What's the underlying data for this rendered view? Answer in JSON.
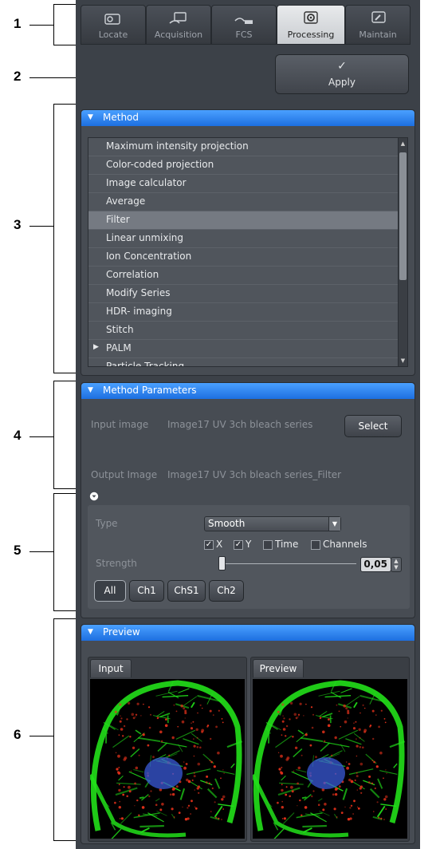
{
  "annotations": [
    "1",
    "2",
    "3",
    "4",
    "5",
    "6"
  ],
  "tabs": [
    {
      "label": "Locate",
      "icon": "locate-icon"
    },
    {
      "label": "Acquisition",
      "icon": "acquisition-icon"
    },
    {
      "label": "FCS",
      "icon": "fcs-icon"
    },
    {
      "label": "Processing",
      "icon": "processing-gear-icon"
    },
    {
      "label": "Maintain",
      "icon": "maintain-wrench-icon"
    }
  ],
  "active_tab": "Processing",
  "apply_button": {
    "check": "✓",
    "label": "Apply"
  },
  "method": {
    "title": "Method",
    "items": [
      "Maximum intensity projection",
      "Color-coded projection",
      "Image calculator",
      "Average",
      "Filter",
      "Linear unmixing",
      "Ion Concentration",
      "Correlation",
      "Modify Series",
      "HDR- imaging",
      "Stitch",
      "PALM",
      "Particle Tracking"
    ],
    "selected": "Filter",
    "expandable": "PALM"
  },
  "method_parameters": {
    "title": "Method Parameters",
    "input_label": "Input image",
    "input_value": "Image17 UV 3ch bleach series",
    "select_label": "Select",
    "output_label": "Output Image",
    "output_value": "Image17 UV 3ch bleach series_Filter",
    "type_label": "Type",
    "type_value": "Smooth",
    "checkboxes": [
      {
        "label": "X",
        "checked": true
      },
      {
        "label": "Y",
        "checked": true
      },
      {
        "label": "Time",
        "checked": false
      },
      {
        "label": "Channels",
        "checked": false
      }
    ],
    "strength_label": "Strength",
    "strength_value": "0,05",
    "strength_level": 0.0,
    "channels": [
      "All",
      "Ch1",
      "ChS1",
      "Ch2"
    ],
    "active_channel": "All"
  },
  "preview": {
    "title": "Preview",
    "windows": [
      "Input",
      "Preview"
    ]
  },
  "colors": {
    "panel_header": "#2a84f0",
    "background": "#3c4148",
    "selected_row": "#757a82",
    "cell_green": "#22e01a",
    "cell_red": "#e0301a",
    "nucleus_blue": "#3a5ad8"
  }
}
